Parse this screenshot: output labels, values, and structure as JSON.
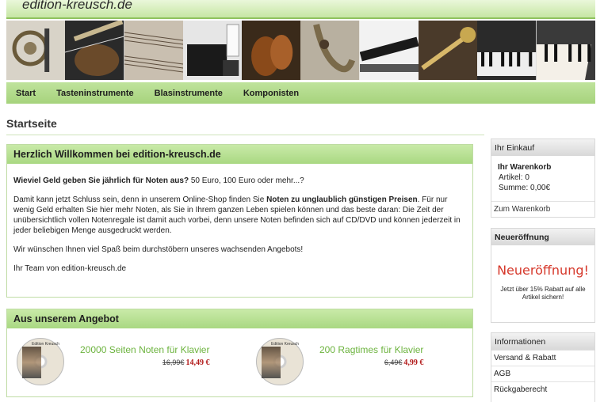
{
  "header": {
    "logo": "edition-kreusch.de"
  },
  "banner": {
    "tiles": [
      "horn",
      "guitar",
      "sheet-music",
      "piano-room",
      "violin",
      "saxophone",
      "clarinet",
      "trumpet",
      "keyboard",
      "piano-keys"
    ]
  },
  "nav": {
    "items": [
      "Start",
      "Tasteninstrumente",
      "Blasinstrumente",
      "Komponisten"
    ]
  },
  "page": {
    "title": "Startseite"
  },
  "welcome": {
    "heading": "Herzlich Willkommen bei edition-kreusch.de",
    "q_bold": "Wieviel Geld geben Sie jährlich für Noten aus?",
    "q_rest": " 50 Euro, 100 Euro oder mehr...?",
    "p2_a": "Damit kann jetzt Schluss sein, denn in unserem Online-Shop finden Sie ",
    "p2_bold": "Noten zu unglaublich günstigen Preisen",
    "p2_b": ". Für nur wenig Geld erhalten Sie hier mehr Noten, als Sie in Ihrem ganzen Leben spielen können und das beste daran: Die Zeit der unübersichtlich vollen Notenregale ist damit auch vorbei, denn unsere Noten befinden sich auf CD/DVD und können jederzeit in jeder beliebigen Menge ausgedruckt werden.",
    "p3": "Wir wünschen Ihnen viel Spaß beim durchstöbern unseres wachsenden Angebots!",
    "p4": "Ihr Team von edition-kreusch.de"
  },
  "offers": {
    "heading": "Aus unserem Angebot",
    "items": [
      {
        "cd_label": "Edition Kreusch",
        "title": "20000 Seiten Noten für Klavier",
        "old_price": "16,99€",
        "new_price": "14,49 €"
      },
      {
        "cd_label": "Edition Kreusch",
        "title": "200 Ragtimes für Klavier",
        "old_price": "6,49€",
        "new_price": "4,99 €"
      }
    ]
  },
  "sidebar": {
    "cart": {
      "heading": "Ihr Einkauf",
      "title": "Ihr Warenkorb",
      "items_label": "Artikel:",
      "items_value": "0",
      "sum_label": "Summe:",
      "sum_value": "0,00€",
      "link": "Zum Warenkorb"
    },
    "opening": {
      "heading": "Neueröffnung",
      "big": "Neueröffnung!",
      "small": "Jetzt über 15% Rabatt auf alle Artikel sichern!"
    },
    "info": {
      "heading": "Informationen",
      "links": [
        "Versand & Rabatt",
        "AGB",
        "Rückgaberecht"
      ]
    }
  },
  "colors": {
    "green": "#a9d882",
    "price_red": "#b21a1a",
    "link_green": "#6cb33e",
    "promo_red": "#d6382b"
  }
}
